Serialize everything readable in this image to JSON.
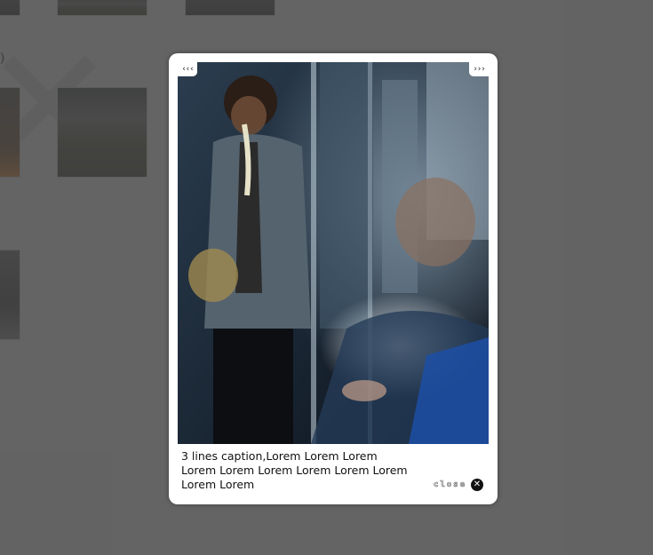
{
  "background": {
    "partial_text": ")"
  },
  "lightbox": {
    "prev_label": "‹‹‹",
    "next_label": "›››",
    "caption": "3 lines caption,Lorem Lorem Lorem Lorem Lorem Lorem Lorem Lorem Lorem Lorem Lorem",
    "close_label": "close",
    "close_icon": "close-x-icon"
  },
  "colors": {
    "overlay": "#595959",
    "panel": "#ffffff",
    "close_icon_bg": "#111111"
  }
}
